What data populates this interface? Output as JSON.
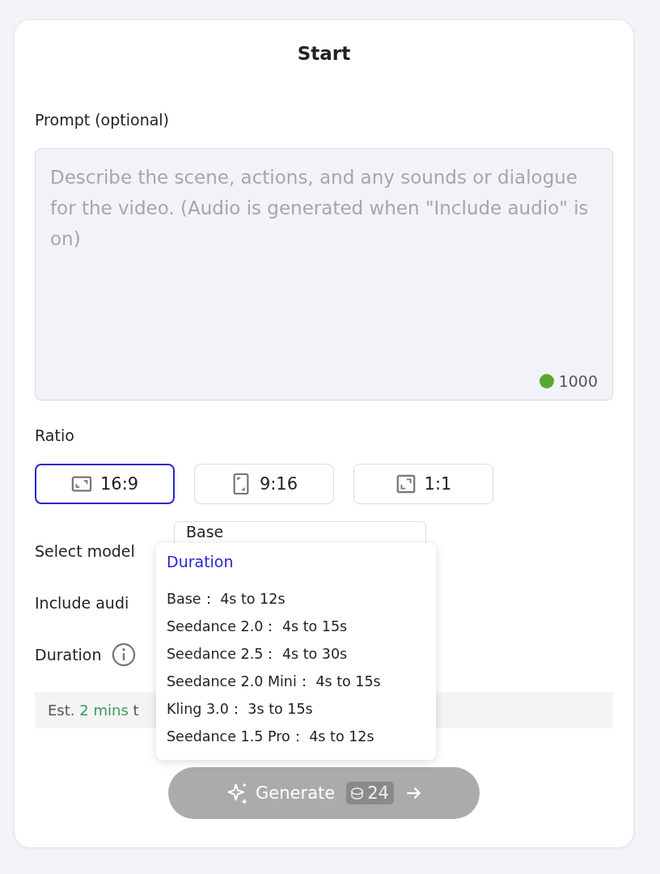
{
  "card": {
    "title": "Start"
  },
  "prompt": {
    "label": "Prompt (optional)",
    "placeholder": "Describe the scene, actions, and any sounds or dialogue for the video. (Audio is generated when \"Include audio\" is on)",
    "counter": {
      "value": "1000",
      "color": "#5aa832"
    }
  },
  "ratio": {
    "label": "Ratio",
    "options": [
      {
        "label": "16:9",
        "kind": "landscape",
        "selected": true
      },
      {
        "label": "9:16",
        "kind": "portrait",
        "selected": false
      },
      {
        "label": "1:1",
        "kind": "square",
        "selected": false
      }
    ]
  },
  "model": {
    "label": "Select model",
    "value": "Base"
  },
  "audio": {
    "label": "Include audi"
  },
  "duration": {
    "label": "Duration"
  },
  "estimate": {
    "prefix": "Est.",
    "time": "2 mins",
    "suffix": "t"
  },
  "popover": {
    "title": "Duration",
    "items": [
      {
        "model": "Base：",
        "range": "4s to 12s"
      },
      {
        "model": "Seedance 2.0：",
        "range": "4s to 15s"
      },
      {
        "model": "Seedance 2.5：",
        "range": "4s to 30s"
      },
      {
        "model": "Seedance 2.0 Mini：",
        "range": "4s to 15s"
      },
      {
        "model": "Kling 3.0：",
        "range": "3s to 15s"
      },
      {
        "model": "Seedance 1.5 Pro：",
        "range": "4s to 12s"
      }
    ]
  },
  "generate": {
    "label": "Generate",
    "cost": "24",
    "disabled": true
  }
}
